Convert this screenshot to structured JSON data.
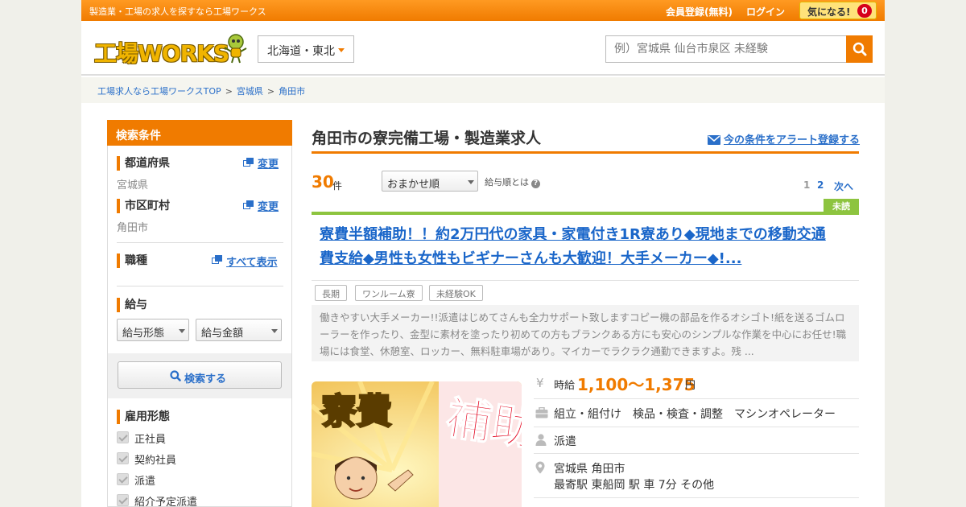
{
  "topbar": {
    "tagline": "製造業・工場の求人を探すなら工場ワークス",
    "signup": "会員登録(無料)",
    "login": "ログイン",
    "favorites_label": "気になる!",
    "favorites_count": "0"
  },
  "header": {
    "logo_text": "工場WORKS",
    "region": "北海道・東北",
    "search_placeholder": "例）宮城県 仙台市泉区 未経験"
  },
  "breadcrumb": [
    "工場求人なら工場ワークスTOP",
    "宮城県",
    "角田市"
  ],
  "sidebar": {
    "title": "検索条件",
    "prefecture": {
      "label": "都道府県",
      "value": "宮城県",
      "change": "変更"
    },
    "city": {
      "label": "市区町村",
      "value": "角田市",
      "change": "変更"
    },
    "job_type": {
      "label": "職種",
      "show_all": "すべて表示"
    },
    "salary": {
      "label": "給与",
      "type_select": "給与形態",
      "amount_select": "給与金額"
    },
    "search_button": "検索する",
    "employment": {
      "label": "雇用形態",
      "options": [
        "正社員",
        "契約社員",
        "派遣",
        "紹介予定派遣"
      ]
    }
  },
  "main": {
    "title": "角田市の寮完備工場・製造業求人",
    "alert_link": "今の条件をアラート登録する",
    "count": "30",
    "count_unit": "件",
    "sort": "おまかせ順",
    "pay_order": "給与順とは",
    "pager": {
      "pages": [
        "1",
        "2"
      ],
      "next": "次へ"
    }
  },
  "job": {
    "badge": "未読",
    "title": "寮費半額補助！！約2万円代の家具・家電付き1R寮あり◆現地までの移動交通費支給◆男性も女性もビギナーさんも大歓迎！大手メーカー◆!...",
    "tags": [
      "長期",
      "ワンルーム寮",
      "未経験OK"
    ],
    "description": "働きやすい大手メーカー!!派遣はじめてさんも全力サポート致しますコピー機の部品を作るオシゴト!紙を送るゴムローラーを作ったり、金型に素材を塗ったり初めての方もブランクある方にも安心のシンプルな作業を中心にお任せ!職場には食堂、休憩室、ロッカー、無料駐車場があり。マイカーでラクラク通勤できますよ。残 ...",
    "image_text_1": "寮費",
    "image_text_2": "補助",
    "salary_label": "時給",
    "salary_value": "1,100～1,375",
    "salary_unit": "円",
    "job_categories": "組立・組付け　検品・検査・調整　マシンオペレーター",
    "employment": "派遣",
    "location": "宮城県 角田市",
    "station": "最寄駅 東船岡 駅 車 7分 その他"
  },
  "colors": {
    "brand_orange": "#f07b00",
    "link_blue": "#2a6fc9",
    "unread_green": "#8dc43f"
  }
}
